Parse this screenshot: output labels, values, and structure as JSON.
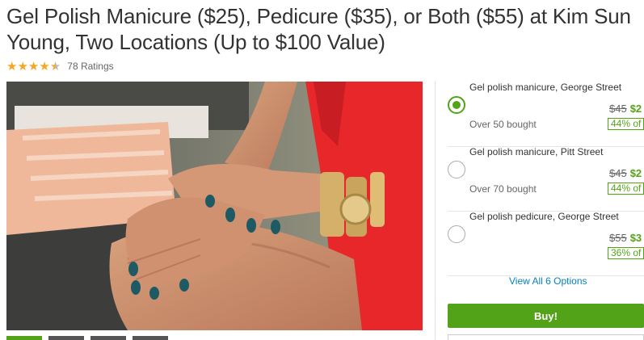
{
  "deal": {
    "title": "Gel Polish Manicure ($25), Pedicure ($35), or Both ($55) at Kim Sun Young, Two Locations (Up to $100 Value)",
    "rating_value": 4.5,
    "rating_count": "78 Ratings"
  },
  "hero": {
    "description_icon": "manicure-photo"
  },
  "options": [
    {
      "name": "Gel polish manicure, George Street",
      "bought": "Over 50 bought",
      "old_price": "$45",
      "new_price": "$2",
      "discount": "44% of",
      "selected": true
    },
    {
      "name": "Gel polish manicure, Pitt Street",
      "bought": "Over 70 bought",
      "old_price": "$45",
      "new_price": "$2",
      "discount": "44% of",
      "selected": false
    },
    {
      "name": "Gel polish pedicure, George Street",
      "bought": "",
      "old_price": "$55",
      "new_price": "$3",
      "discount": "36% of",
      "selected": false
    }
  ],
  "view_all_label": "View All 6 Options",
  "buy_label": "Buy!",
  "colors": {
    "accent": "#53a318",
    "link": "#0981b9",
    "star": "#f5a623"
  }
}
